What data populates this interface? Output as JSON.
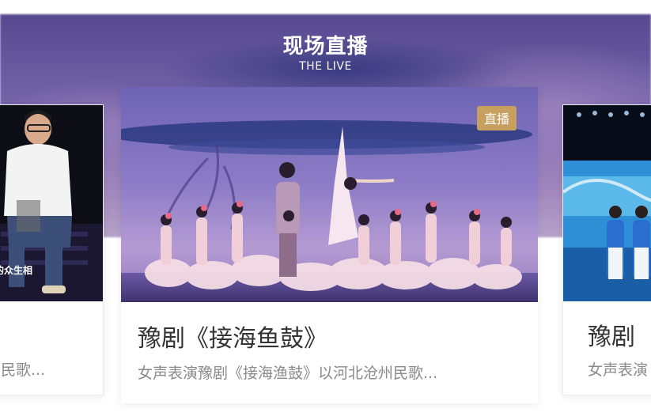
{
  "section": {
    "title": "现场直播",
    "subtitle": "THE LIVE"
  },
  "cards": [
    {
      "title": "",
      "description": "民歌...",
      "overlay_text": "的众生相"
    },
    {
      "badge": "直播",
      "title": "豫剧《接海鱼鼓》",
      "description": "女声表演豫剧《接海渔鼓》以河北沧州民歌..."
    },
    {
      "title": "豫剧",
      "description": "女声表演"
    }
  ],
  "colors": {
    "badge_bg": "#c79f5e",
    "title_text": "#333333",
    "desc_text": "#8a8a8a"
  }
}
